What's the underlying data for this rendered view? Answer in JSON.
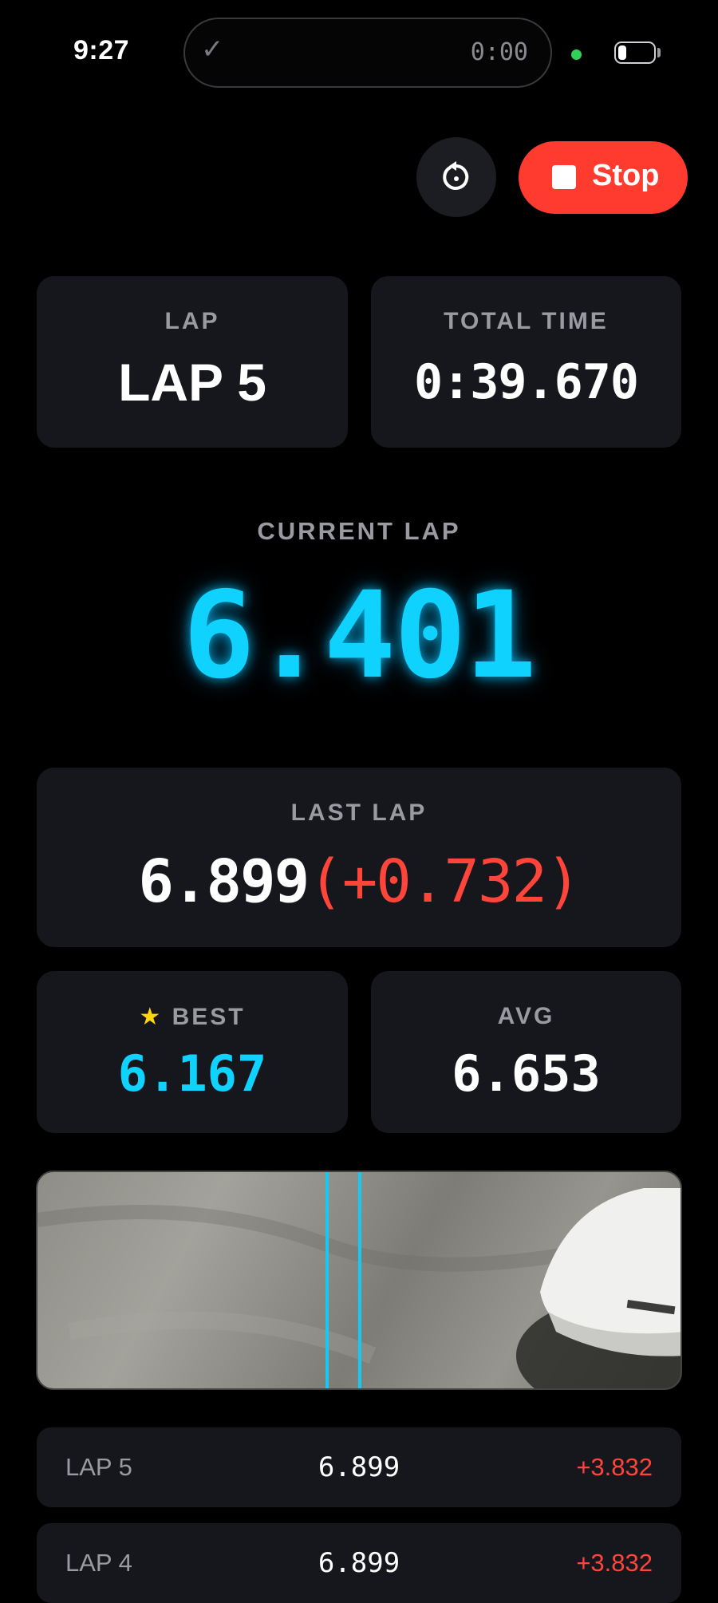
{
  "status_bar": {
    "time": "9:27",
    "timer": "0:00"
  },
  "controls": {
    "stop_label": "Stop"
  },
  "lap": {
    "label": "LAP",
    "value": "LAP 5"
  },
  "total_time": {
    "label": "TOTAL TIME",
    "value": "0:39.670"
  },
  "current_lap": {
    "label": "CURRENT LAP",
    "value": "6.401"
  },
  "last_lap": {
    "label": "LAST LAP",
    "value": "6.899",
    "delta": "(+0.732)"
  },
  "best": {
    "label": "BEST",
    "value": "6.167"
  },
  "avg": {
    "label": "AVG",
    "value": "6.653"
  },
  "laps": [
    {
      "label": "LAP 5",
      "time": "6.899",
      "delta": "+3.832"
    },
    {
      "label": "LAP 4",
      "time": "6.899",
      "delta": "+3.832"
    }
  ],
  "colors": {
    "accent": "#0fd2ff",
    "stop": "#ff3b30",
    "delta": "#ff453a",
    "star": "#ffd60a",
    "card": "#16171d"
  }
}
